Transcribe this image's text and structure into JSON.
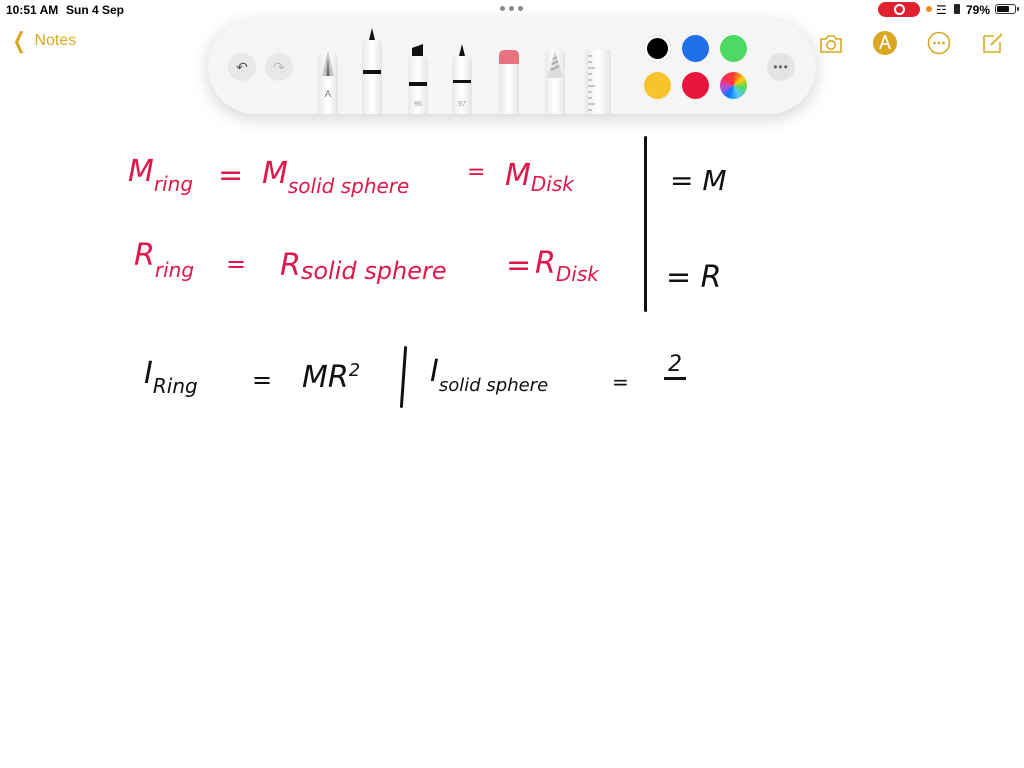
{
  "status_bar": {
    "time": "10:51 AM",
    "date": "Sun 4 Sep",
    "battery_percent": "79%",
    "battery_level": 0.79,
    "recording_indicator_color": "#e0212f"
  },
  "nav": {
    "back_label": "Notes",
    "accent_color": "#d9a820",
    "icons": [
      "camera-icon",
      "markup-icon",
      "more-icon",
      "compose-icon"
    ]
  },
  "toolbar": {
    "undo": "undo-icon",
    "redo": "redo-icon",
    "tools": [
      {
        "name": "monoline-pen",
        "label": "A"
      },
      {
        "name": "pen",
        "label": ""
      },
      {
        "name": "marker",
        "label": "96"
      },
      {
        "name": "fineliner",
        "label": "97"
      },
      {
        "name": "eraser",
        "label": ""
      },
      {
        "name": "pencil",
        "label": ""
      },
      {
        "name": "ruler",
        "label": ""
      }
    ],
    "colors": [
      {
        "name": "black",
        "hex": "#000000",
        "selected": true
      },
      {
        "name": "blue",
        "hex": "#1f6fe8",
        "selected": false
      },
      {
        "name": "green",
        "hex": "#4cd964",
        "selected": false
      },
      {
        "name": "yellow",
        "hex": "#f7c52b",
        "selected": false
      },
      {
        "name": "red",
        "hex": "#e8163c",
        "selected": false
      },
      {
        "name": "multicolor",
        "hex": "",
        "selected": false
      }
    ],
    "more_label": "•••"
  },
  "note": {
    "line1": {
      "m_ring": "M",
      "m_ring_sub": "ring",
      "eq1": "=",
      "m_solid": "M",
      "m_solid_sub": "solid sphere",
      "eq2": "=",
      "m_disk": "M",
      "m_disk_sub": "Disk",
      "result": "= M"
    },
    "line2": {
      "r_ring": "R",
      "r_ring_sub": "ring",
      "eq1": "=",
      "r_solid": "R",
      "r_solid_sub": "solid sphere",
      "eq2": "=",
      "r_disk": "R",
      "r_disk_sub": "Disk",
      "result": "= R"
    },
    "line3": {
      "i_ring": "I",
      "i_ring_sub": "Ring",
      "eq1": "=",
      "i_ring_val": "MR",
      "i_ring_exp": "2",
      "i_solid": "I",
      "i_solid_sub": "solid sphere",
      "eq2": "=",
      "i_solid_val": "2"
    }
  }
}
